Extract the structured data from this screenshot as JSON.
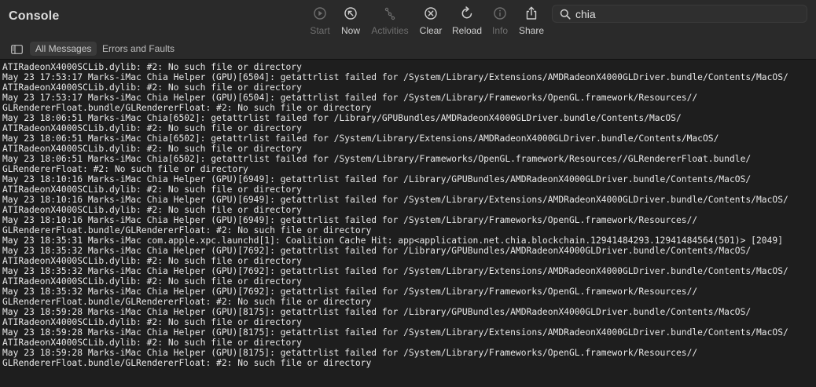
{
  "window": {
    "title": "Console"
  },
  "toolbar": {
    "start_label": "Start",
    "now_label": "Now",
    "activities_label": "Activities",
    "clear_label": "Clear",
    "reload_label": "Reload",
    "info_label": "Info",
    "share_label": "Share",
    "icons": {
      "start": "play-circle-icon",
      "now": "arrow-up-left-circle-icon",
      "activities": "activity-nodes-icon",
      "clear": "x-circle-icon",
      "reload": "reload-icon",
      "info": "info-circle-icon",
      "share": "share-icon"
    }
  },
  "search": {
    "value": "chia",
    "icon": "search-icon"
  },
  "filters": {
    "all_messages": "All Messages",
    "errors_and_faults": "Errors and Faults",
    "active": "all_messages",
    "sidebar_icon": "sidebar-toggle-icon"
  },
  "log": {
    "lines": [
      "ATIRadeonX4000SCLib.dylib: #2: No such file or directory",
      "May 23 17:53:17 Marks-iMac Chia Helper (GPU)[6504]: getattrlist failed for /System/Library/Extensions/AMDRadeonX4000GLDriver.bundle/Contents/MacOS/",
      "ATIRadeonX4000SCLib.dylib: #2: No such file or directory",
      "May 23 17:53:17 Marks-iMac Chia Helper (GPU)[6504]: getattrlist failed for /System/Library/Frameworks/OpenGL.framework/Resources//",
      "GLRendererFloat.bundle/GLRendererFloat: #2: No such file or directory",
      "May 23 18:06:51 Marks-iMac Chia[6502]: getattrlist failed for /Library/GPUBundles/AMDRadeonX4000GLDriver.bundle/Contents/MacOS/",
      "ATIRadeonX4000SCLib.dylib: #2: No such file or directory",
      "May 23 18:06:51 Marks-iMac Chia[6502]: getattrlist failed for /System/Library/Extensions/AMDRadeonX4000GLDriver.bundle/Contents/MacOS/",
      "ATIRadeonX4000SCLib.dylib: #2: No such file or directory",
      "May 23 18:06:51 Marks-iMac Chia[6502]: getattrlist failed for /System/Library/Frameworks/OpenGL.framework/Resources//GLRendererFloat.bundle/",
      "GLRendererFloat: #2: No such file or directory",
      "May 23 18:10:16 Marks-iMac Chia Helper (GPU)[6949]: getattrlist failed for /Library/GPUBundles/AMDRadeonX4000GLDriver.bundle/Contents/MacOS/",
      "ATIRadeonX4000SCLib.dylib: #2: No such file or directory",
      "May 23 18:10:16 Marks-iMac Chia Helper (GPU)[6949]: getattrlist failed for /System/Library/Extensions/AMDRadeonX4000GLDriver.bundle/Contents/MacOS/",
      "ATIRadeonX4000SCLib.dylib: #2: No such file or directory",
      "May 23 18:10:16 Marks-iMac Chia Helper (GPU)[6949]: getattrlist failed for /System/Library/Frameworks/OpenGL.framework/Resources//",
      "GLRendererFloat.bundle/GLRendererFloat: #2: No such file or directory",
      "May 23 18:35:31 Marks-iMac com.apple.xpc.launchd[1]: Coalition Cache Hit: app<application.net.chia.blockchain.12941484293.12941484564(501)> [2049]",
      "May 23 18:35:32 Marks-iMac Chia Helper (GPU)[7692]: getattrlist failed for /Library/GPUBundles/AMDRadeonX4000GLDriver.bundle/Contents/MacOS/",
      "ATIRadeonX4000SCLib.dylib: #2: No such file or directory",
      "May 23 18:35:32 Marks-iMac Chia Helper (GPU)[7692]: getattrlist failed for /System/Library/Extensions/AMDRadeonX4000GLDriver.bundle/Contents/MacOS/",
      "ATIRadeonX4000SCLib.dylib: #2: No such file or directory",
      "May 23 18:35:32 Marks-iMac Chia Helper (GPU)[7692]: getattrlist failed for /System/Library/Frameworks/OpenGL.framework/Resources//",
      "GLRendererFloat.bundle/GLRendererFloat: #2: No such file or directory",
      "May 23 18:59:28 Marks-iMac Chia Helper (GPU)[8175]: getattrlist failed for /Library/GPUBundles/AMDRadeonX4000GLDriver.bundle/Contents/MacOS/",
      "ATIRadeonX4000SCLib.dylib: #2: No such file or directory",
      "May 23 18:59:28 Marks-iMac Chia Helper (GPU)[8175]: getattrlist failed for /System/Library/Extensions/AMDRadeonX4000GLDriver.bundle/Contents/MacOS/",
      "ATIRadeonX4000SCLib.dylib: #2: No such file or directory",
      "May 23 18:59:28 Marks-iMac Chia Helper (GPU)[8175]: getattrlist failed for /System/Library/Frameworks/OpenGL.framework/Resources//",
      "GLRendererFloat.bundle/GLRendererFloat: #2: No such file or directory"
    ]
  },
  "colors": {
    "toolbar_bg": "#2a2a2a",
    "log_bg": "#1e1e1e",
    "text": "#e8e8e8",
    "disabled": "#6f6f6f"
  }
}
